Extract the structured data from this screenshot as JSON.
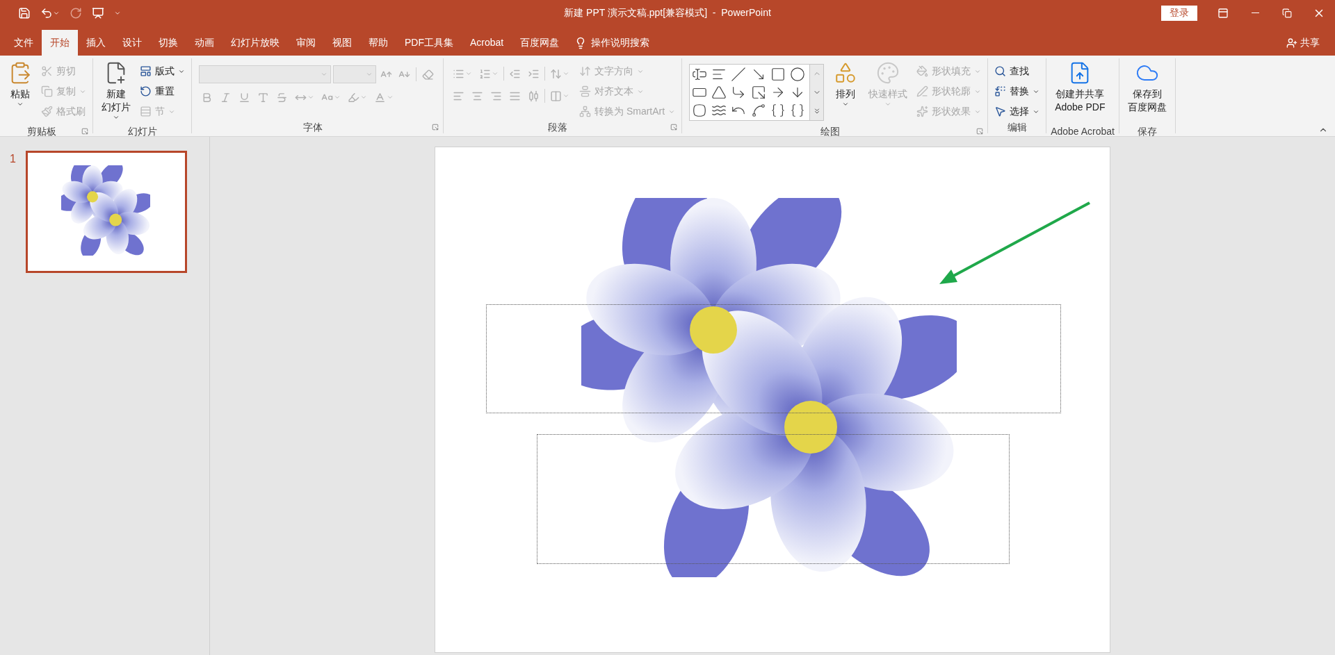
{
  "title_bar": {
    "title": "新建 PPT 演示文稿.ppt[兼容模式]  -  PowerPoint",
    "login": "登录"
  },
  "menu_tabs": [
    {
      "label": "文件",
      "selected": false
    },
    {
      "label": "开始",
      "selected": true
    },
    {
      "label": "插入",
      "selected": false
    },
    {
      "label": "设计",
      "selected": false
    },
    {
      "label": "切换",
      "selected": false
    },
    {
      "label": "动画",
      "selected": false
    },
    {
      "label": "幻灯片放映",
      "selected": false
    },
    {
      "label": "审阅",
      "selected": false
    },
    {
      "label": "视图",
      "selected": false
    },
    {
      "label": "帮助",
      "selected": false
    },
    {
      "label": "PDF工具集",
      "selected": false
    },
    {
      "label": "Acrobat",
      "selected": false
    },
    {
      "label": "百度网盘",
      "selected": false
    }
  ],
  "tell_me": "操作说明搜索",
  "share": "共享",
  "ribbon": {
    "groups": [
      {
        "label": "剪贴板",
        "launcher": true,
        "items": [
          {
            "kind": "large",
            "label_lines": [
              "粘贴"
            ],
            "dropdown": true,
            "disabled": false
          },
          {
            "kind": "stack",
            "items": [
              {
                "label": "剪切",
                "dropdown": false,
                "disabled": true
              },
              {
                "label": "复制",
                "dropdown": true,
                "disabled": true
              },
              {
                "label": "格式刷",
                "dropdown": false,
                "disabled": true
              }
            ]
          }
        ]
      },
      {
        "label": "幻灯片",
        "items": [
          {
            "kind": "large",
            "label_lines": [
              "新建",
              "幻灯片"
            ],
            "dropdown": true,
            "disabled": false
          },
          {
            "kind": "stack",
            "items": [
              {
                "label": "版式",
                "dropdown": true,
                "disabled": false
              },
              {
                "label": "重置",
                "dropdown": false,
                "disabled": false
              },
              {
                "label": "节",
                "dropdown": true,
                "disabled": true
              }
            ]
          }
        ]
      },
      {
        "label": "字体",
        "launcher": true,
        "items": [
          {
            "kind": "font",
            "disabled": true
          }
        ]
      },
      {
        "label": "段落",
        "launcher": true,
        "items": [
          {
            "kind": "paragraph",
            "disabled": true
          },
          {
            "kind": "stack",
            "items": [
              {
                "label": "文字方向",
                "dropdown": true,
                "disabled": true
              },
              {
                "label": "对齐文本",
                "dropdown": true,
                "disabled": true
              },
              {
                "label": "转换为 SmartArt",
                "dropdown": true,
                "disabled": true
              }
            ]
          }
        ]
      },
      {
        "label": "绘图",
        "launcher": true,
        "items": [
          {
            "kind": "gallery",
            "disabled": false
          },
          {
            "kind": "large",
            "label_lines": [
              "排列"
            ],
            "dropdown": true,
            "disabled": false
          },
          {
            "kind": "large",
            "label_lines": [
              "快速样式"
            ],
            "dropdown": true,
            "disabled": true
          },
          {
            "kind": "stack",
            "items": [
              {
                "label": "形状填充",
                "dropdown": true,
                "disabled": true
              },
              {
                "label": "形状轮廓",
                "dropdown": true,
                "disabled": true
              },
              {
                "label": "形状效果",
                "dropdown": true,
                "disabled": true
              }
            ]
          }
        ]
      },
      {
        "label": "编辑",
        "items": [
          {
            "kind": "stack",
            "items": [
              {
                "label": "查找",
                "dropdown": false,
                "disabled": false
              },
              {
                "label": "替换",
                "dropdown": true,
                "disabled": false
              },
              {
                "label": "选择",
                "dropdown": true,
                "disabled": false
              }
            ]
          }
        ]
      },
      {
        "label": "Adobe Acrobat",
        "items": [
          {
            "kind": "large",
            "label_lines": [
              "创建并共享",
              "Adobe PDF"
            ],
            "dropdown": false,
            "disabled": false
          }
        ]
      },
      {
        "label": "保存",
        "items": [
          {
            "kind": "large",
            "label_lines": [
              "保存到",
              "百度网盘"
            ],
            "dropdown": false,
            "disabled": false
          }
        ]
      }
    ]
  },
  "slides_panel": {
    "slides": [
      {
        "number": "1",
        "selected": true
      }
    ]
  }
}
